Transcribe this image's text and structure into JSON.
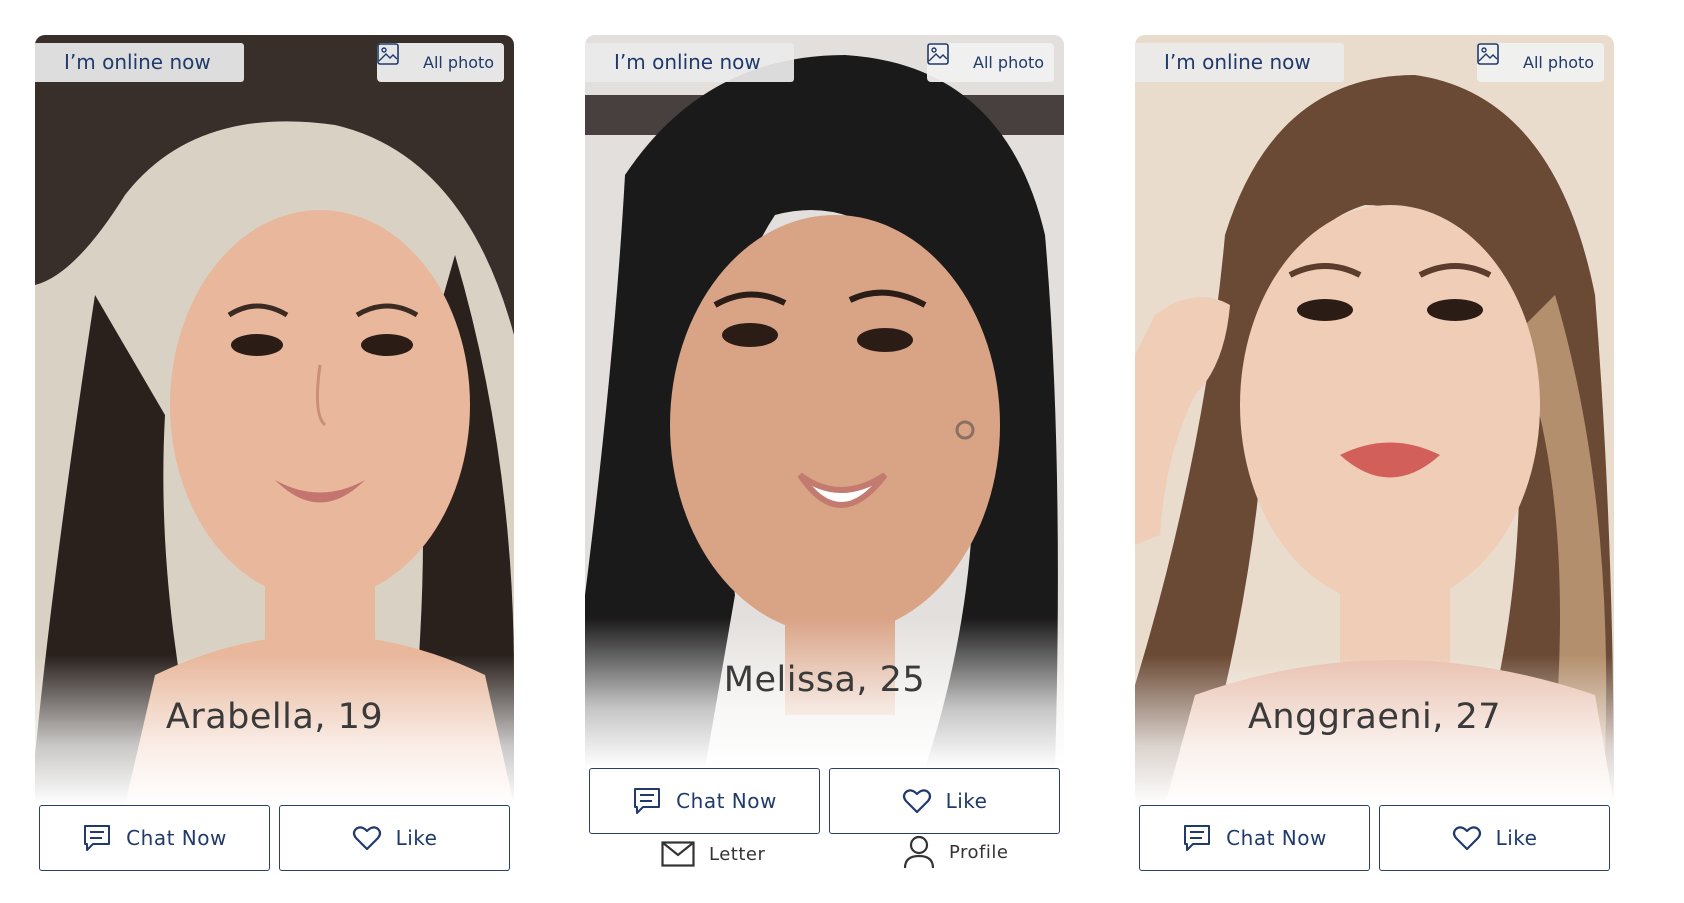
{
  "profiles": [
    {
      "online_label": "I’m online now",
      "all_photo_label": "All photo",
      "name_age": "Arabella, 19",
      "chat_label": "Chat Now",
      "like_label": "Like",
      "hair_color": "#2a211d",
      "skin_color": "#e8b79c",
      "bg_color": "#d9d2c4"
    },
    {
      "online_label": "I’m online now",
      "all_photo_label": "All photo",
      "name_age": "Melissa, 25",
      "chat_label": "Chat Now",
      "like_label": "Like",
      "letter_label": "Letter",
      "profile_label": "Profile",
      "hair_color": "#1b1a1a",
      "skin_color": "#d9a386",
      "bg_color": "#e3dfdc"
    },
    {
      "online_label": "I’m online now",
      "all_photo_label": "All photo",
      "name_age": "Anggraeni, 27",
      "chat_label": "Chat Now",
      "like_label": "Like",
      "hair_color": "#6b4a35",
      "skin_color": "#efcdb7",
      "bg_color": "#e9dccd"
    }
  ],
  "colors": {
    "accent": "#1f3a6b",
    "button_border": "#2a3f6c",
    "name_text": "#3a3a3a"
  },
  "icons": {
    "chat": "chat-bubble-icon",
    "like": "heart-icon",
    "all_photo": "image-icon",
    "letter": "envelope-icon",
    "profile": "person-icon"
  }
}
